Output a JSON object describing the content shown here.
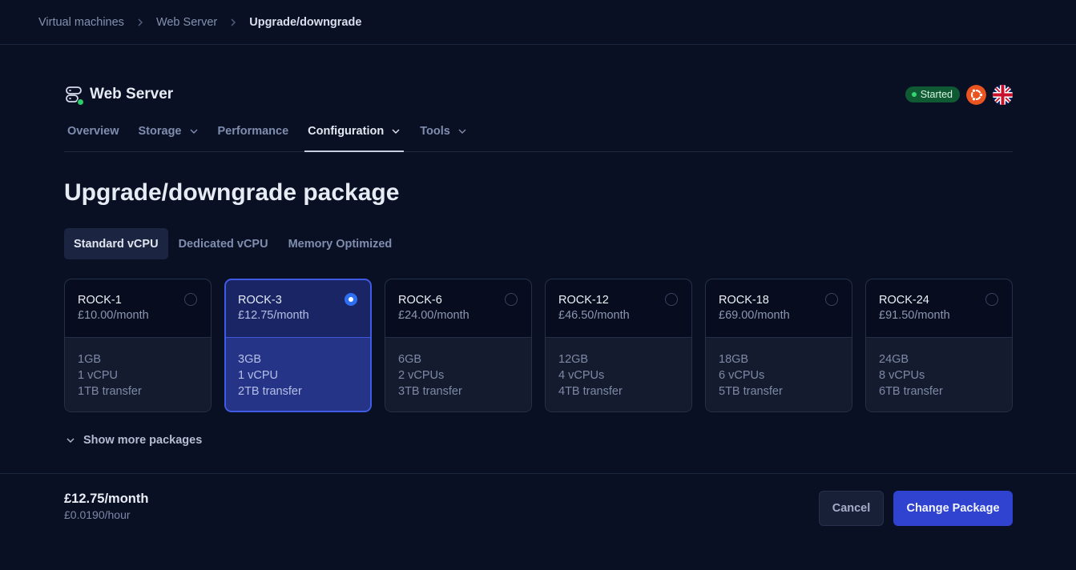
{
  "breadcrumb": {
    "items": [
      {
        "label": "Virtual machines"
      },
      {
        "label": "Web Server"
      },
      {
        "label": "Upgrade/downgrade"
      }
    ]
  },
  "vm": {
    "title": "Web Server",
    "status": "Started",
    "status_color": "#0f5a33",
    "online_indicator_color": "#2ccd6a",
    "os_icon": "ubuntu-icon",
    "region_icon": "uk-flag-icon"
  },
  "tabs": [
    {
      "label": "Overview",
      "has_dropdown": false,
      "active": false
    },
    {
      "label": "Storage",
      "has_dropdown": true,
      "active": false
    },
    {
      "label": "Performance",
      "has_dropdown": false,
      "active": false
    },
    {
      "label": "Configuration",
      "has_dropdown": true,
      "active": true
    },
    {
      "label": "Tools",
      "has_dropdown": true,
      "active": false
    }
  ],
  "page_title": "Upgrade/downgrade package",
  "categories": [
    {
      "label": "Standard vCPU",
      "active": true
    },
    {
      "label": "Dedicated vCPU",
      "active": false
    },
    {
      "label": "Memory Optimized",
      "active": false
    }
  ],
  "packages": [
    {
      "name": "ROCK-1",
      "price": "£10.00/month",
      "ram": "1GB",
      "cpu": "1 vCPU",
      "transfer": "1TB transfer",
      "selected": false
    },
    {
      "name": "ROCK-3",
      "price": "£12.75/month",
      "ram": "3GB",
      "cpu": "1 vCPU",
      "transfer": "2TB transfer",
      "selected": true
    },
    {
      "name": "ROCK-6",
      "price": "£24.00/month",
      "ram": "6GB",
      "cpu": "2 vCPUs",
      "transfer": "3TB transfer",
      "selected": false
    },
    {
      "name": "ROCK-12",
      "price": "£46.50/month",
      "ram": "12GB",
      "cpu": "4 vCPUs",
      "transfer": "4TB transfer",
      "selected": false
    },
    {
      "name": "ROCK-18",
      "price": "£69.00/month",
      "ram": "18GB",
      "cpu": "6 vCPUs",
      "transfer": "5TB transfer",
      "selected": false
    },
    {
      "name": "ROCK-24",
      "price": "£91.50/month",
      "ram": "24GB",
      "cpu": "8 vCPUs",
      "transfer": "6TB transfer",
      "selected": false
    }
  ],
  "show_more_label": "Show more packages",
  "footer": {
    "monthly_price": "£12.75/month",
    "hourly_price": "£0.0190/hour",
    "cancel_label": "Cancel",
    "submit_label": "Change Package",
    "accent_color": "#2f42d0"
  }
}
